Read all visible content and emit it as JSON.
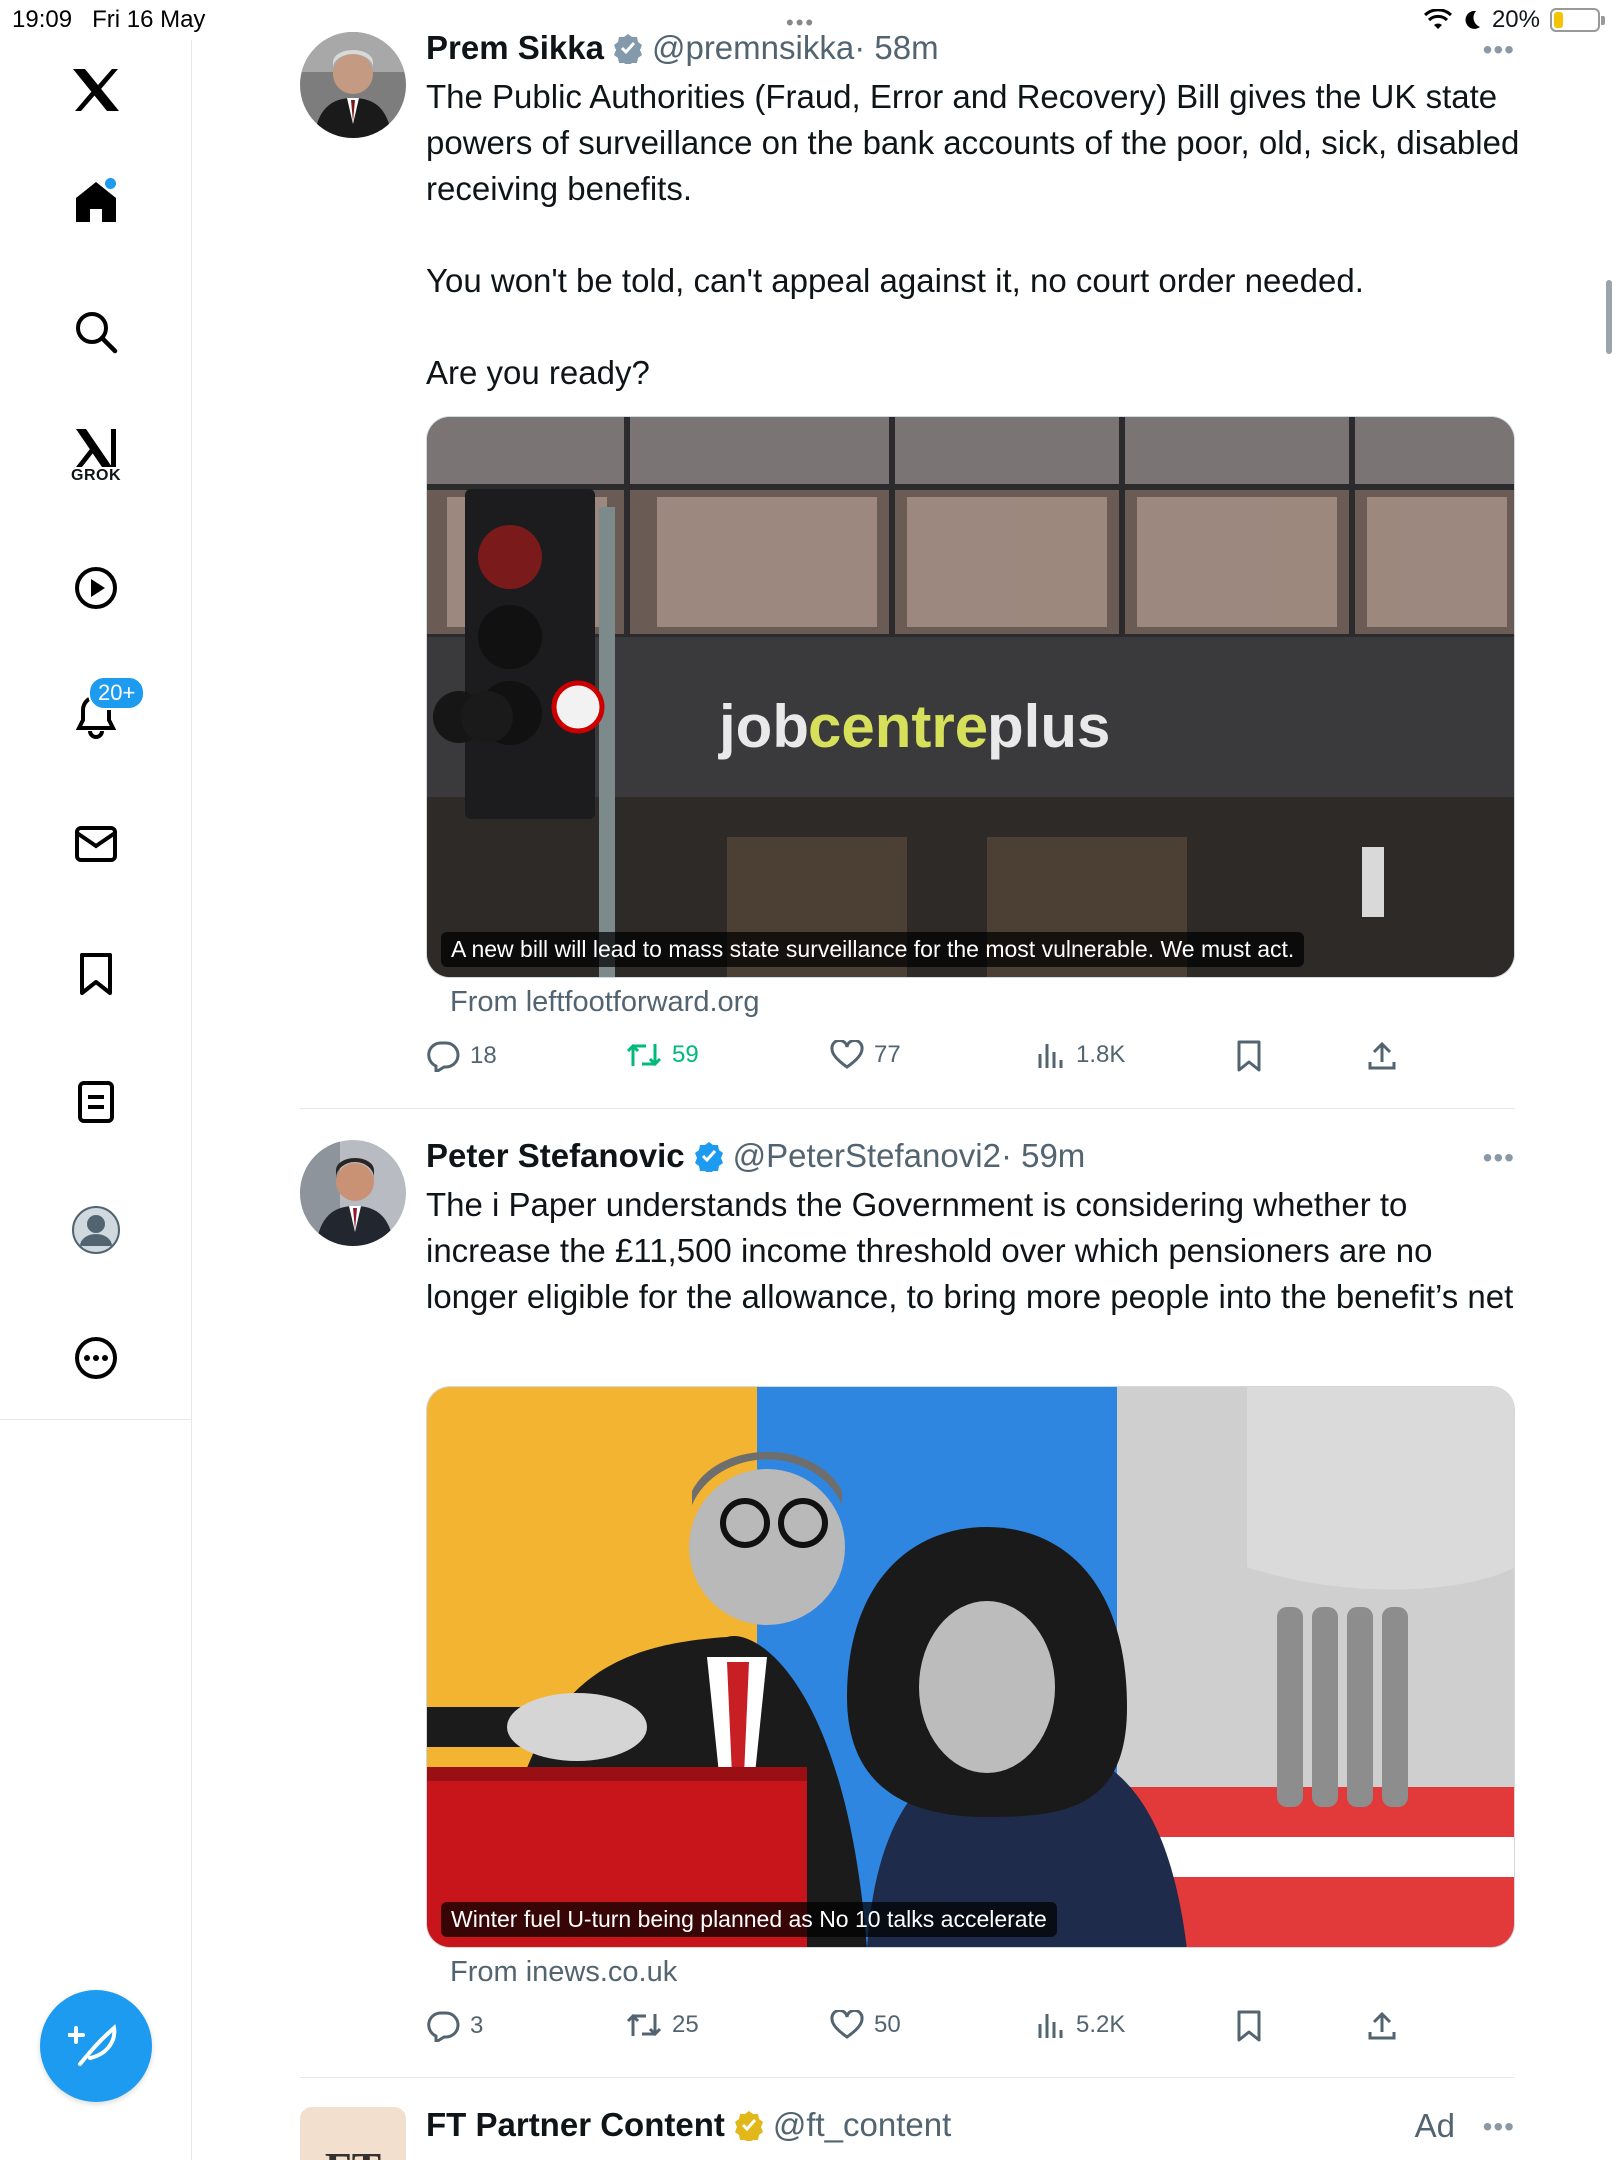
{
  "status_bar": {
    "time": "19:09",
    "date": "Fri 16 May",
    "battery": "20%"
  },
  "sidebar": {
    "notifications_badge": "20+",
    "grok_label": "GROK"
  },
  "tweets": [
    {
      "name": "Prem Sikka",
      "handle": "@premnsikka",
      "time": "· 58m",
      "text": "The Public Authorities (Fraud, Error and Recovery) Bill gives the UK state powers of surveillance on the bank accounts of the poor, old, sick, disabled receiving benefits.\n\nYou won't be told, can't appeal against it, no court order needed.\n\nAre you ready?",
      "image_sign": "jobcentreplus",
      "image_sign_prefix": "job",
      "image_sign_mid": "centre",
      "image_sign_suffix": "plus",
      "caption": "A new bill will lead to mass state surveillance for the most vulnerable. We must act.",
      "source": "From leftfootforward.org",
      "replies": "18",
      "retweets": "59",
      "likes": "77",
      "views": "1.8K"
    },
    {
      "name": "Peter Stefanovic",
      "handle": "@PeterStefanovi2",
      "time": "· 59m",
      "text": "The i Paper understands the Government is considering whether to increase the £11,500 income threshold over which pensioners are no longer eligible for the allowance, to bring more people into the benefit’s net",
      "caption": "Winter fuel U-turn being planned as No 10 talks accelerate",
      "source": "From inews.co.uk",
      "replies": "3",
      "retweets": "25",
      "likes": "50",
      "views": "5.2K"
    },
    {
      "name": "FT Partner Content",
      "handle": "@ft_content",
      "ad_label": "Ad",
      "avatar_text": "FT"
    }
  ],
  "colors": {
    "accent": "#1d9bf0",
    "retweet_active": "#00ba7c",
    "secondary_text": "#536471"
  }
}
